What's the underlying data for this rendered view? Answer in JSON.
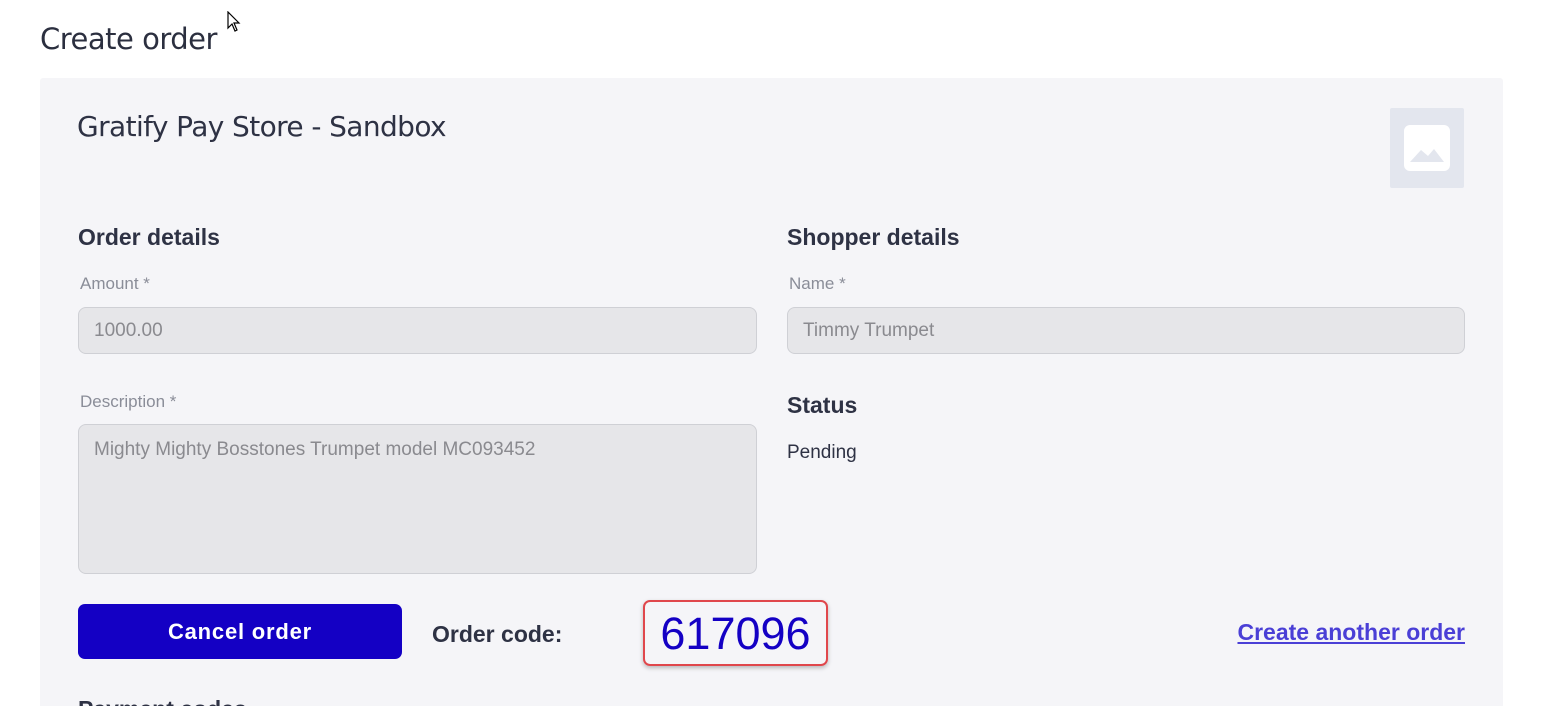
{
  "page": {
    "title": "Create order"
  },
  "store": {
    "name": "Gratify Pay Store - Sandbox",
    "logo_icon": "image-placeholder-icon"
  },
  "order_details": {
    "title": "Order details",
    "amount_label": "Amount *",
    "amount_value": "1000.00",
    "description_label": "Description *",
    "description_value": "Mighty Mighty Bosstones Trumpet model MC093452"
  },
  "shopper_details": {
    "title": "Shopper details",
    "name_label": "Name *",
    "name_value": "Timmy Trumpet"
  },
  "status": {
    "title": "Status",
    "value": "Pending"
  },
  "actions": {
    "cancel_label": "Cancel order",
    "order_code_label": "Order code:",
    "order_code_value": "617096",
    "create_another_label": "Create another order"
  },
  "payment": {
    "title": "Payment codes"
  },
  "colors": {
    "primary": "#1400c4",
    "link": "#4a3fd6",
    "highlight_border": "#e0474c",
    "card_bg": "#f5f5f8"
  }
}
